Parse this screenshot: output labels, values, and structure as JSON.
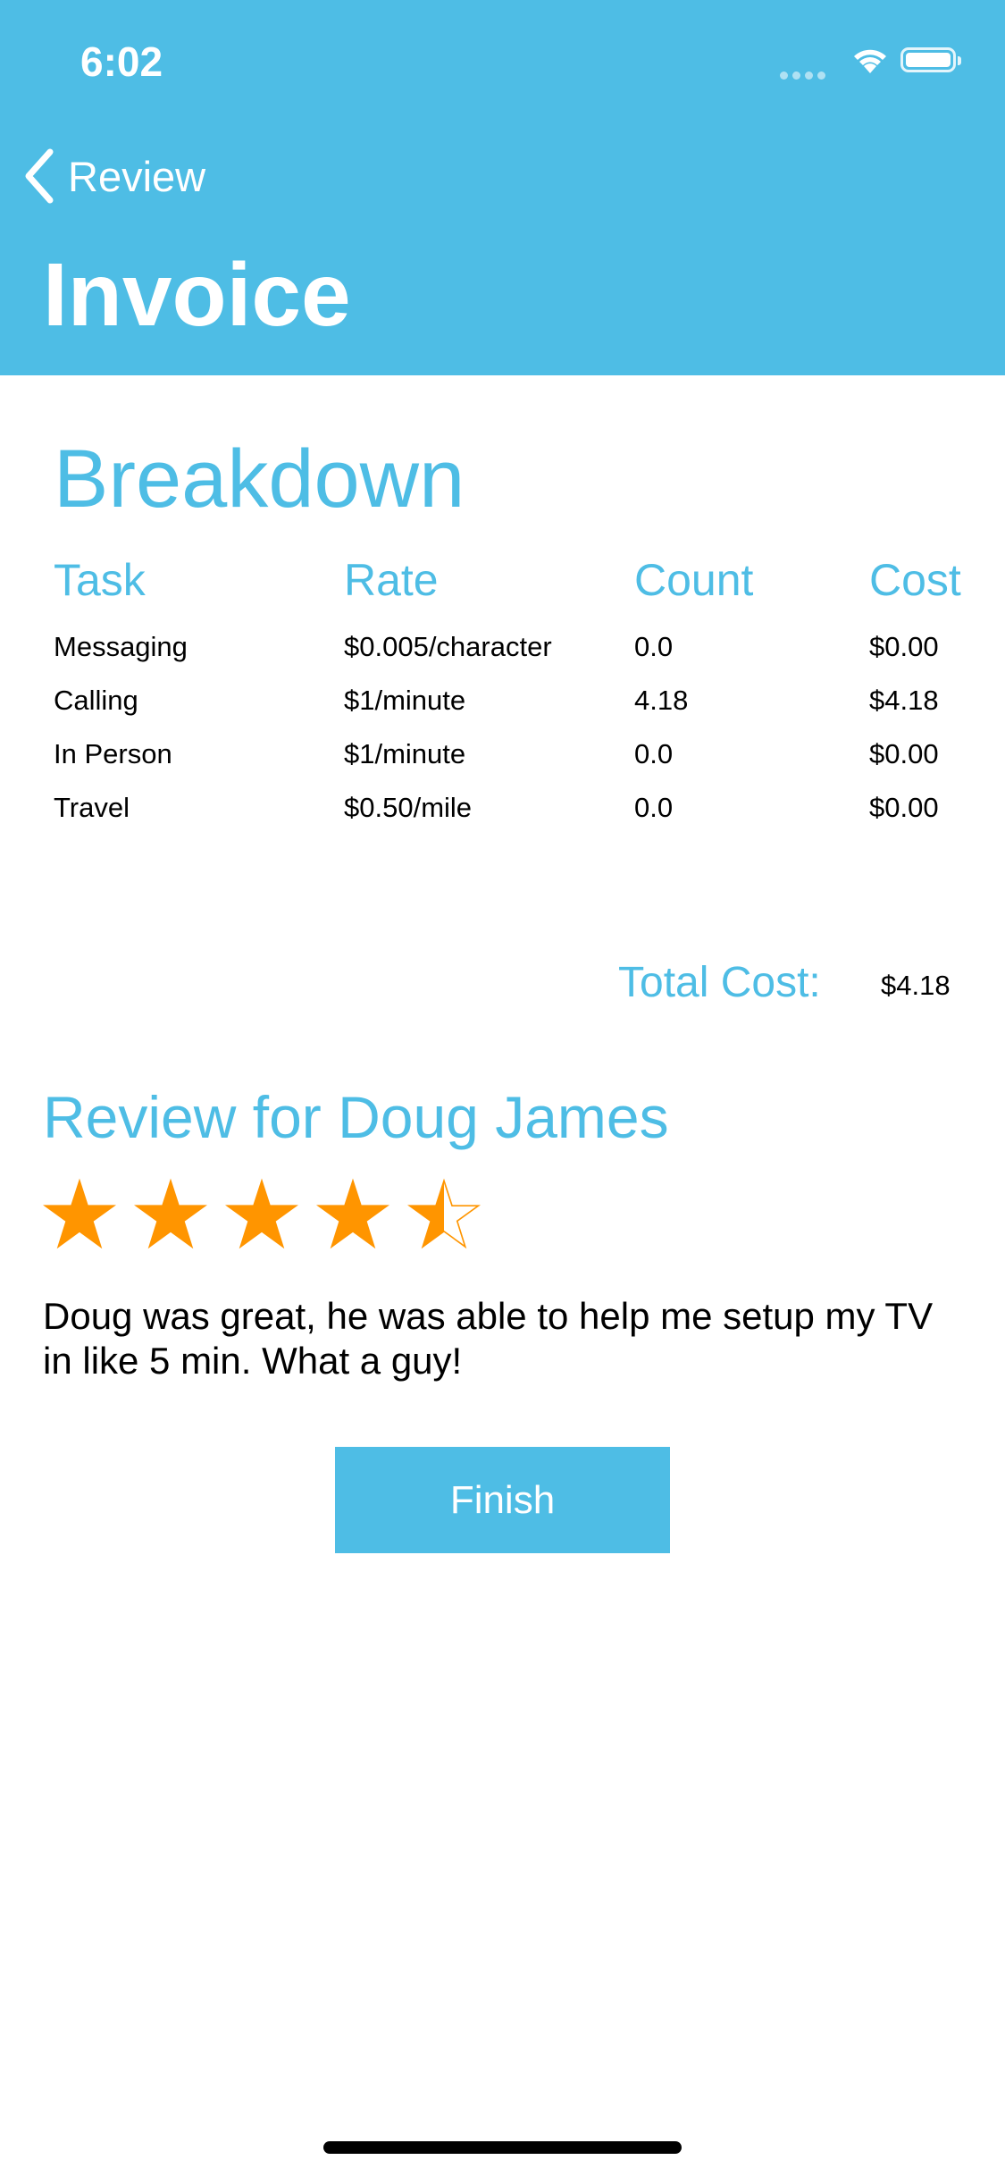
{
  "status_bar": {
    "time": "6:02"
  },
  "nav": {
    "back_label": "Review",
    "title": "Invoice"
  },
  "breakdown": {
    "title": "Breakdown",
    "columns": [
      "Task",
      "Rate",
      "Count",
      "Cost"
    ],
    "rows": [
      [
        "Messaging",
        "$0.005/character",
        "0.0",
        "$0.00"
      ],
      [
        "Calling",
        "$1/minute",
        "4.18",
        "$4.18"
      ],
      [
        "In Person",
        "$1/minute",
        "0.0",
        "$0.00"
      ],
      [
        "Travel",
        "$0.50/mile",
        "0.0",
        "$0.00"
      ]
    ],
    "total_label": "Total Cost:",
    "total_value": "$4.18"
  },
  "review": {
    "title": "Review for Doug James",
    "rating": 4.5,
    "max_rating": 5,
    "text": "Doug was great, he was able to help me setup my TV in like 5 min. What a guy!"
  },
  "finish_label": "Finish",
  "colors": {
    "accent": "#4EBDE5",
    "star": "#FF9500"
  }
}
